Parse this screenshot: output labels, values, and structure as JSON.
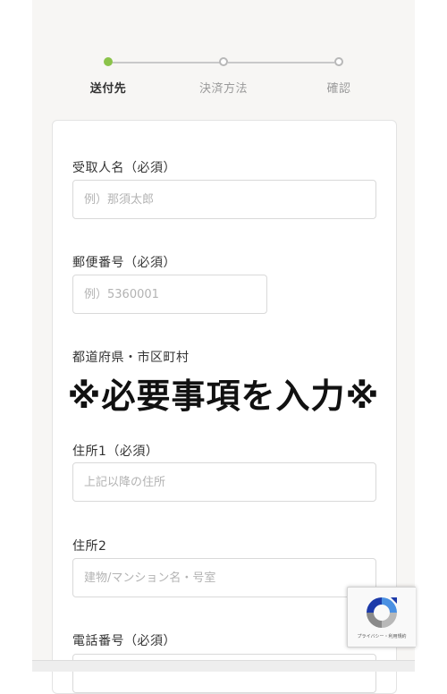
{
  "stepper": {
    "steps": [
      {
        "label": "送付先",
        "active": true
      },
      {
        "label": "決済方法",
        "active": false
      },
      {
        "label": "確認",
        "active": false
      }
    ]
  },
  "form": {
    "recipient_name": {
      "label": "受取人名（必須）",
      "placeholder": "例）那須太郎"
    },
    "postal_code": {
      "label": "郵便番号（必須）",
      "placeholder": "例）5360001"
    },
    "prefecture_city": {
      "label": "都道府県・市区町村"
    },
    "address1": {
      "label": "住所1（必須）",
      "placeholder": "上記以降の住所"
    },
    "address2": {
      "label": "住所2",
      "placeholder": "建物/マンション名・号室"
    },
    "phone": {
      "label": "電話番号（必須）"
    }
  },
  "overlay": {
    "text": "※必要事項を入力※"
  },
  "recaptcha": {
    "text": "プライバシー・利用規約"
  },
  "colors": {
    "accent": "#8bc34a",
    "background": "#f7f6f4"
  }
}
